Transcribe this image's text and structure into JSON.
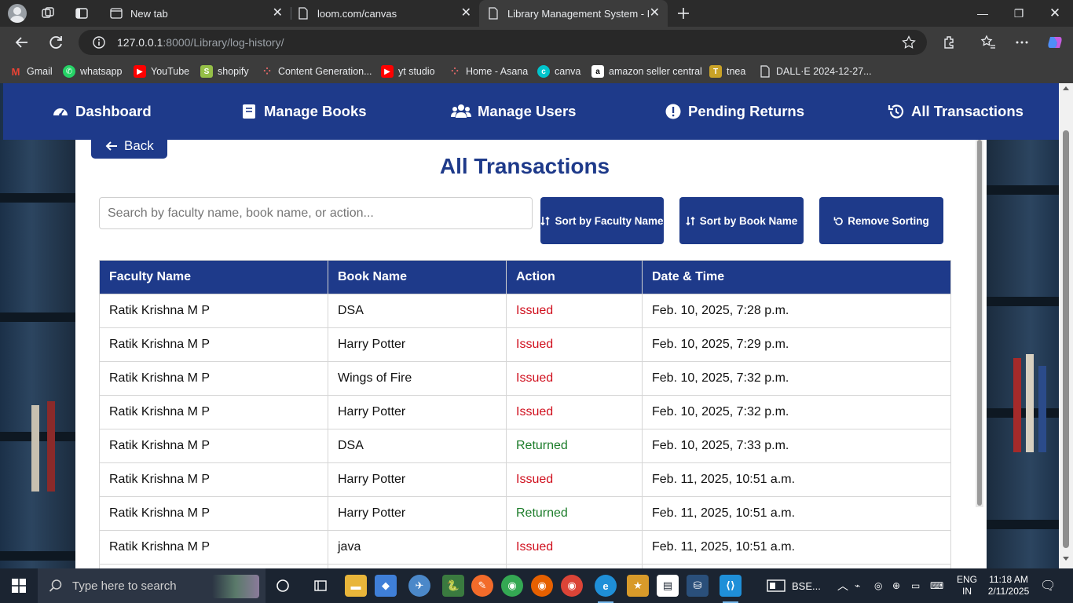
{
  "browser": {
    "tabs": [
      {
        "label": "New tab"
      },
      {
        "label": "loom.com/canvas"
      },
      {
        "label": "Library Management System - Bo"
      }
    ],
    "url_host": "127.0.0.1",
    "url_rest": ":8000/Library/log-history/",
    "bookmarks": [
      {
        "label": "Gmail",
        "icon": "gmail-icon",
        "color": "#ea4335"
      },
      {
        "label": "whatsapp",
        "icon": "whatsapp-icon",
        "color": "#25d366"
      },
      {
        "label": "YouTube",
        "icon": "youtube-icon",
        "color": "#ff0000"
      },
      {
        "label": "shopify",
        "icon": "shopify-icon",
        "color": "#95bf47"
      },
      {
        "label": "Content Generation...",
        "icon": "asana-icon",
        "color": "#f06a6a"
      },
      {
        "label": "yt studio",
        "icon": "youtube-icon",
        "color": "#ff0000"
      },
      {
        "label": "Home - Asana",
        "icon": "asana-icon",
        "color": "#f06a6a"
      },
      {
        "label": "canva",
        "icon": "canva-icon",
        "color": "#00c4cc"
      },
      {
        "label": "amazon seller central",
        "icon": "amazon-icon",
        "color": "#ffffff"
      },
      {
        "label": "tnea",
        "icon": "tnea-icon",
        "color": "#c9a227"
      },
      {
        "label": "DALL·E 2024-12-27...",
        "icon": "file-icon",
        "color": "#e8eaed"
      }
    ]
  },
  "nav": {
    "dashboard": "Dashboard",
    "manage_books": "Manage Books",
    "manage_users": "Manage Users",
    "pending_returns": "Pending Returns",
    "all_transactions": "All Transactions"
  },
  "page": {
    "back_label": "Back",
    "title": "All Transactions",
    "search_placeholder": "Search by faculty name, book name, or action...",
    "sort_faculty": "Sort by Faculty Name",
    "sort_book": "Sort by Book Name",
    "remove_sorting": "Remove Sorting"
  },
  "table": {
    "headers": [
      "Faculty Name",
      "Book Name",
      "Action",
      "Date & Time"
    ],
    "rows": [
      [
        "Ratik Krishna M P",
        "DSA",
        "Issued",
        "Feb. 10, 2025, 7:28 p.m."
      ],
      [
        "Ratik Krishna M P",
        "Harry Potter",
        "Issued",
        "Feb. 10, 2025, 7:29 p.m."
      ],
      [
        "Ratik Krishna M P",
        "Wings of Fire",
        "Issued",
        "Feb. 10, 2025, 7:32 p.m."
      ],
      [
        "Ratik Krishna M P",
        "Harry Potter",
        "Issued",
        "Feb. 10, 2025, 7:32 p.m."
      ],
      [
        "Ratik Krishna M P",
        "DSA",
        "Returned",
        "Feb. 10, 2025, 7:33 p.m."
      ],
      [
        "Ratik Krishna M P",
        "Harry Potter",
        "Issued",
        "Feb. 11, 2025, 10:51 a.m."
      ],
      [
        "Ratik Krishna M P",
        "Harry Potter",
        "Returned",
        "Feb. 11, 2025, 10:51 a.m."
      ],
      [
        "Ratik Krishna M P",
        "java",
        "Issued",
        "Feb. 11, 2025, 10:51 a.m."
      ]
    ]
  },
  "colors": {
    "primary": "#1e3a8a",
    "issued": "#d0101e",
    "returned": "#1c7c2a"
  },
  "taskbar": {
    "search_placeholder": "Type here to search",
    "bse_label": "BSE...",
    "lang_line1": "ENG",
    "lang_line2": "IN",
    "time": "11:18 AM",
    "date": "2/11/2025"
  }
}
